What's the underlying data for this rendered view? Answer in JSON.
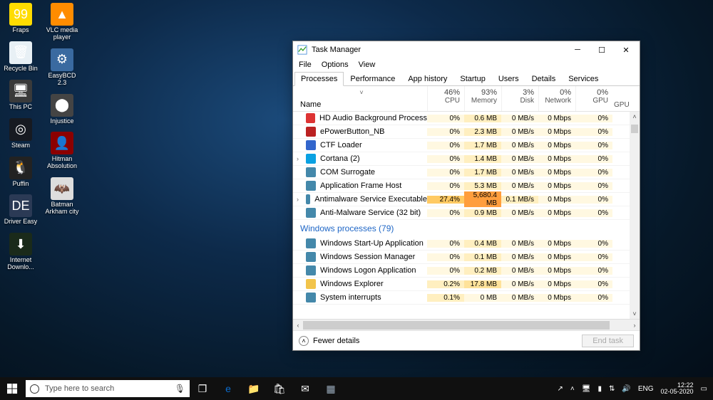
{
  "desktop": {
    "cols": [
      [
        {
          "label": "Fraps",
          "color": "#ffdc00",
          "glyph": "99"
        },
        {
          "label": "Recycle Bin",
          "color": "#e8f0f5",
          "glyph": "🗑"
        },
        {
          "label": "This PC",
          "color": "#3a3a3a",
          "glyph": "🖥"
        },
        {
          "label": "Steam",
          "color": "#171a21",
          "glyph": "◎"
        },
        {
          "label": "Puffin",
          "color": "#222",
          "glyph": "🐧"
        },
        {
          "label": "Driver Easy",
          "color": "#2b3a55",
          "glyph": "DE"
        },
        {
          "label": "Internet Downlo...",
          "color": "#1a2a1a",
          "glyph": "⬇"
        }
      ],
      [
        {
          "label": "VLC media player",
          "color": "#ff8c00",
          "glyph": "▲"
        },
        {
          "label": "EasyBCD 2.3",
          "color": "#3a6aa0",
          "glyph": "⚙"
        },
        {
          "label": "Injustice",
          "color": "#444",
          "glyph": "⬤"
        },
        {
          "label": "Hitman Absolution",
          "color": "#8b0000",
          "glyph": "👤"
        },
        {
          "label": "Batman Arkham city",
          "color": "#ddd",
          "glyph": "🦇"
        }
      ]
    ]
  },
  "taskbar": {
    "search_placeholder": "Type here to search",
    "items": [
      {
        "name": "taskview",
        "glyph": "❐"
      },
      {
        "name": "edge",
        "glyph": "e",
        "color": "#0b6bcb"
      },
      {
        "name": "explorer",
        "glyph": "📁",
        "color": "#f2c44b"
      },
      {
        "name": "store",
        "glyph": "🛍",
        "color": "#fff"
      },
      {
        "name": "mail",
        "glyph": "✉",
        "color": "#fff"
      },
      {
        "name": "taskmgr",
        "glyph": "▦",
        "color": "#9ab"
      }
    ],
    "tray": {
      "share": "↗",
      "up": "˄",
      "monitor": "🖥",
      "battery": "▮",
      "wifi": "⇅",
      "volume": "🔊",
      "lang": "ENG",
      "time": "12:22",
      "date": "02-05-2020",
      "notif": "▭"
    }
  },
  "taskmgr": {
    "title": "Task Manager",
    "menu": [
      "File",
      "Options",
      "View"
    ],
    "tabs": [
      "Processes",
      "Performance",
      "App history",
      "Startup",
      "Users",
      "Details",
      "Services"
    ],
    "active_tab": 0,
    "columns": {
      "name": "Name",
      "metrics": [
        {
          "pct": "46%",
          "label": "CPU"
        },
        {
          "pct": "93%",
          "label": "Memory"
        },
        {
          "pct": "3%",
          "label": "Disk"
        },
        {
          "pct": "0%",
          "label": "Network"
        },
        {
          "pct": "0%",
          "label": "GPU"
        }
      ],
      "extra": "GPU"
    },
    "rows": [
      {
        "type": "proc",
        "expand": false,
        "name": "HD Audio Background Process",
        "icon": "#d33",
        "cpu": "0%",
        "mem": "0.6 MB",
        "disk": "0 MB/s",
        "net": "0 Mbps",
        "gpu": "0%",
        "heat": [
          0,
          1,
          0,
          0,
          0
        ]
      },
      {
        "type": "proc",
        "expand": false,
        "name": "ePowerButton_NB",
        "icon": "#b22",
        "cpu": "0%",
        "mem": "2.3 MB",
        "disk": "0 MB/s",
        "net": "0 Mbps",
        "gpu": "0%",
        "heat": [
          0,
          1,
          0,
          0,
          0
        ]
      },
      {
        "type": "proc",
        "expand": false,
        "name": "CTF Loader",
        "icon": "#36c",
        "cpu": "0%",
        "mem": "1.7 MB",
        "disk": "0 MB/s",
        "net": "0 Mbps",
        "gpu": "0%",
        "heat": [
          0,
          1,
          0,
          0,
          0
        ]
      },
      {
        "type": "proc",
        "expand": true,
        "name": "Cortana (2)",
        "icon": "#0aa1e2",
        "cpu": "0%",
        "mem": "1.4 MB",
        "disk": "0 MB/s",
        "net": "0 Mbps",
        "gpu": "0%",
        "heat": [
          0,
          1,
          0,
          0,
          0
        ]
      },
      {
        "type": "proc",
        "expand": false,
        "name": "COM Surrogate",
        "icon": "#48a",
        "cpu": "0%",
        "mem": "1.7 MB",
        "disk": "0 MB/s",
        "net": "0 Mbps",
        "gpu": "0%",
        "heat": [
          0,
          1,
          0,
          0,
          0
        ]
      },
      {
        "type": "proc",
        "expand": false,
        "name": "Application Frame Host",
        "icon": "#48a",
        "cpu": "0%",
        "mem": "5.3 MB",
        "disk": "0 MB/s",
        "net": "0 Mbps",
        "gpu": "0%",
        "heat": [
          0,
          1,
          0,
          0,
          0
        ]
      },
      {
        "type": "proc",
        "expand": true,
        "name": "Antimalware Service Executable",
        "icon": "#48a",
        "cpu": "27.4%",
        "mem": "5,680.4 MB",
        "disk": "0.1 MB/s",
        "net": "0 Mbps",
        "gpu": "0%",
        "heat": [
          3,
          4,
          1,
          0,
          0
        ]
      },
      {
        "type": "proc",
        "expand": false,
        "name": "Anti-Malware Service (32 bit)",
        "icon": "#48a",
        "cpu": "0%",
        "mem": "0.9 MB",
        "disk": "0 MB/s",
        "net": "0 Mbps",
        "gpu": "0%",
        "heat": [
          0,
          1,
          0,
          0,
          0
        ]
      },
      {
        "type": "group",
        "name": "Windows processes (79)"
      },
      {
        "type": "proc",
        "expand": false,
        "name": "Windows Start-Up Application",
        "icon": "#48a",
        "cpu": "0%",
        "mem": "0.4 MB",
        "disk": "0 MB/s",
        "net": "0 Mbps",
        "gpu": "0%",
        "heat": [
          0,
          1,
          0,
          0,
          0
        ]
      },
      {
        "type": "proc",
        "expand": false,
        "name": "Windows Session Manager",
        "icon": "#48a",
        "cpu": "0%",
        "mem": "0.1 MB",
        "disk": "0 MB/s",
        "net": "0 Mbps",
        "gpu": "0%",
        "heat": [
          0,
          1,
          0,
          0,
          0
        ]
      },
      {
        "type": "proc",
        "expand": false,
        "name": "Windows Logon Application",
        "icon": "#48a",
        "cpu": "0%",
        "mem": "0.2 MB",
        "disk": "0 MB/s",
        "net": "0 Mbps",
        "gpu": "0%",
        "heat": [
          0,
          1,
          0,
          0,
          0
        ]
      },
      {
        "type": "proc",
        "expand": false,
        "name": "Windows Explorer",
        "icon": "#f2c44b",
        "cpu": "0.2%",
        "mem": "17.8 MB",
        "disk": "0 MB/s",
        "net": "0 Mbps",
        "gpu": "0%",
        "heat": [
          1,
          2,
          0,
          0,
          0
        ]
      },
      {
        "type": "proc",
        "expand": false,
        "name": "System interrupts",
        "icon": "#48a",
        "cpu": "0.1%",
        "mem": "0 MB",
        "disk": "0 MB/s",
        "net": "0 Mbps",
        "gpu": "0%",
        "heat": [
          1,
          0,
          0,
          0,
          0
        ]
      }
    ],
    "footer": {
      "fewer": "Fewer details",
      "endtask": "End task"
    }
  }
}
